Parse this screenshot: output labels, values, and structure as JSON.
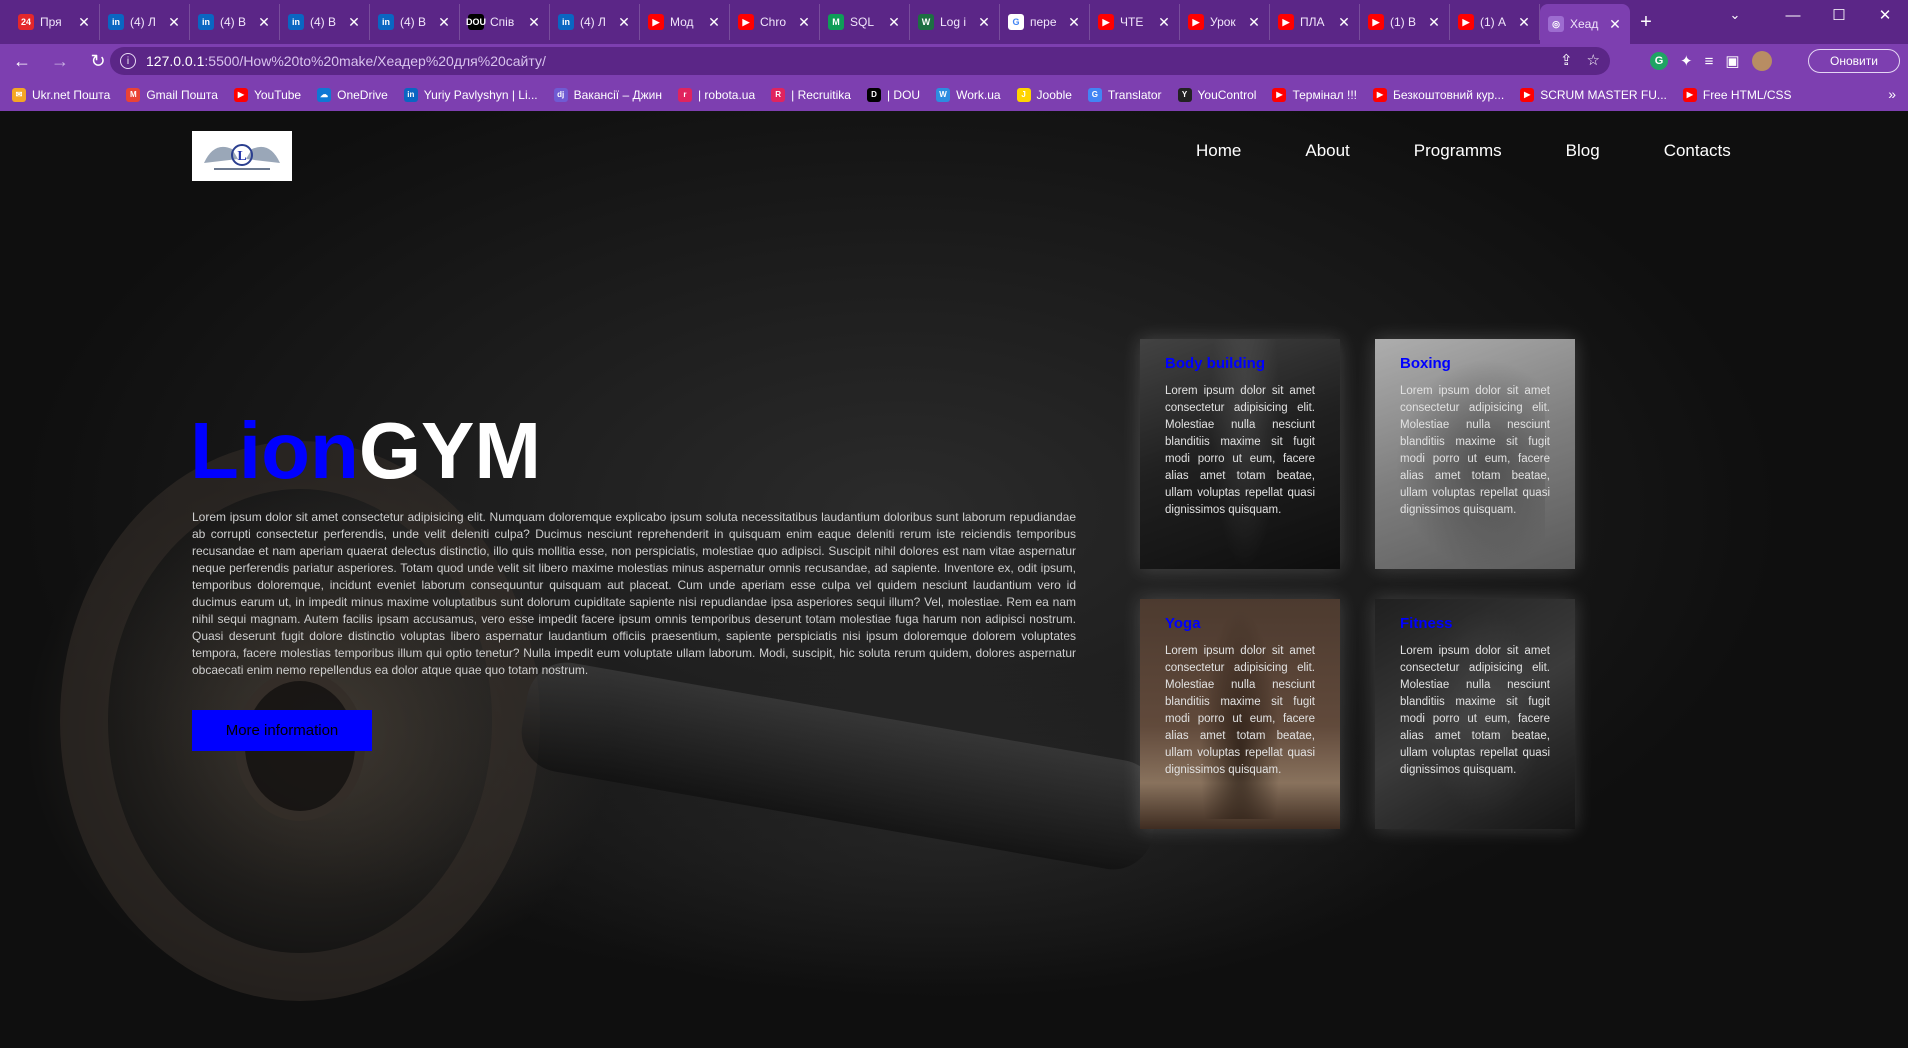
{
  "browser": {
    "tabs": [
      {
        "title": "Пря",
        "icon": "news24-icon",
        "color": "#e4272b",
        "glyph": "24"
      },
      {
        "title": "(4) Л",
        "icon": "linkedin-icon",
        "color": "#0a66c2",
        "glyph": "in"
      },
      {
        "title": "(4) В",
        "icon": "linkedin-icon",
        "color": "#0a66c2",
        "glyph": "in"
      },
      {
        "title": "(4) В",
        "icon": "linkedin-icon",
        "color": "#0a66c2",
        "glyph": "in"
      },
      {
        "title": "(4) В",
        "icon": "linkedin-icon",
        "color": "#0a66c2",
        "glyph": "in"
      },
      {
        "title": "Спів",
        "icon": "dou-icon",
        "color": "#000000",
        "glyph": "DOU"
      },
      {
        "title": "(4) Л",
        "icon": "linkedin-icon",
        "color": "#0a66c2",
        "glyph": "in"
      },
      {
        "title": "Мод",
        "icon": "youtube-icon",
        "color": "#ff0000",
        "glyph": "▶"
      },
      {
        "title": "Chro",
        "icon": "youtube-icon",
        "color": "#ff0000",
        "glyph": "▶"
      },
      {
        "title": "SQL",
        "icon": "sql-icon",
        "color": "#0f9d58",
        "glyph": "M"
      },
      {
        "title": "Log i",
        "icon": "w-icon",
        "color": "#1d6f42",
        "glyph": "W"
      },
      {
        "title": "пере",
        "icon": "google-icon",
        "color": "#ffffff",
        "glyph": "G"
      },
      {
        "title": "ЧТЕ",
        "icon": "youtube-icon",
        "color": "#ff0000",
        "glyph": "▶"
      },
      {
        "title": "Урок",
        "icon": "youtube-icon",
        "color": "#ff0000",
        "glyph": "▶"
      },
      {
        "title": "ПЛА",
        "icon": "youtube-icon",
        "color": "#ff0000",
        "glyph": "▶"
      },
      {
        "title": "(1) В",
        "icon": "youtube-icon",
        "color": "#ff0000",
        "glyph": "▶"
      },
      {
        "title": "(1) А",
        "icon": "youtube-icon",
        "color": "#ff0000",
        "glyph": "▶"
      },
      {
        "title": "Хеад",
        "icon": "globe-icon",
        "color": "#9d6cd0",
        "glyph": "◎",
        "active": true
      }
    ],
    "url_host": "127.0.0.1",
    "url_path": ":5500/How%20to%20make/Хеадер%20для%20сайту/",
    "update_label": "Оновити",
    "bookmarks": [
      {
        "label": "Ukr.net Пошта",
        "color": "#f5a623",
        "glyph": "✉"
      },
      {
        "label": "Gmail Пошта",
        "color": "#ea4335",
        "glyph": "M"
      },
      {
        "label": "YouTube",
        "color": "#ff0000",
        "glyph": "▶"
      },
      {
        "label": "OneDrive",
        "color": "#0f78d4",
        "glyph": "☁"
      },
      {
        "label": "Yuriy Pavlyshyn | Li...",
        "color": "#0a66c2",
        "glyph": "in"
      },
      {
        "label": "Вакансії – Джин",
        "color": "#6f5bd3",
        "glyph": "dj"
      },
      {
        "label": "| robota.ua",
        "color": "#e0245e",
        "glyph": "r"
      },
      {
        "label": "| Recruitika",
        "color": "#e0245e",
        "glyph": "R"
      },
      {
        "label": "| DOU",
        "color": "#000000",
        "glyph": "D"
      },
      {
        "label": "Work.ua",
        "color": "#2c8de0",
        "glyph": "W"
      },
      {
        "label": "Jooble",
        "color": "#ffd400",
        "glyph": "J"
      },
      {
        "label": "Translator",
        "color": "#4285f4",
        "glyph": "G"
      },
      {
        "label": "YouControl",
        "color": "#222222",
        "glyph": "Y"
      },
      {
        "label": "Термінал !!!",
        "color": "#ff0000",
        "glyph": "▶"
      },
      {
        "label": "Безкоштовний кур...",
        "color": "#ff0000",
        "glyph": "▶"
      },
      {
        "label": "SCRUM MASTER FU...",
        "color": "#ff0000",
        "glyph": "▶"
      },
      {
        "label": "Free HTML/CSS",
        "color": "#ff0000",
        "glyph": "▶"
      }
    ]
  },
  "site": {
    "nav": [
      "Home",
      "About",
      "Programms",
      "Blog",
      "Contacts"
    ],
    "title_a": "Lion",
    "title_b": "GYM",
    "hero_text": "Lorem ipsum dolor sit amet consectetur adipisicing elit. Numquam doloremque explicabo ipsum soluta necessitatibus laudantium doloribus sunt laborum repudiandae ab corrupti consectetur perferendis, unde velit deleniti culpa? Ducimus nesciunt reprehenderit in quisquam enim eaque deleniti rerum iste reiciendis temporibus recusandae et nam aperiam quaerat delectus distinctio, illo quis mollitia esse, non perspiciatis, molestiae quo adipisci. Suscipit nihil dolores est nam vitae aspernatur neque perferendis pariatur asperiores. Totam quod unde velit sit libero maxime molestias minus aspernatur omnis recusandae, ad sapiente. Inventore ex, odit ipsum, temporibus doloremque, incidunt eveniet laborum consequuntur quisquam aut placeat. Cum unde aperiam esse culpa vel quidem nesciunt laudantium vero id ducimus earum ut, in impedit minus maxime voluptatibus sunt dolorum cupiditate sapiente nisi repudiandae ipsa asperiores sequi illum? Vel, molestiae. Rem ea nam nihil sequi magnam. Autem facilis ipsam accusamus, vero esse impedit facere ipsum omnis temporibus deserunt totam molestiae fuga harum non adipisci nostrum. Quasi deserunt fugit dolore distinctio voluptas libero aspernatur laudantium officiis praesentium, sapiente perspiciatis nisi ipsum doloremque dolorem voluptates tempora, facere molestias temporibus illum qui optio tenetur? Nulla impedit eum voluptate ullam laborum. Modi, suscipit, hic soluta rerum quidem, dolores aspernatur obcaecati enim nemo repellendus ea dolor atque quae quo totam nostrum.",
    "button": "More information",
    "cards": [
      {
        "title": "Body building",
        "text": "Lorem ipsum dolor sit amet consectetur adipisicing elit. Molestiae nulla nesciunt blanditiis maxime sit fugit modi porro ut eum, facere alias amet totam beatae, ullam voluptas repellat quasi dignissimos quisquam."
      },
      {
        "title": "Boxing",
        "text": "Lorem ipsum dolor sit amet consectetur adipisicing elit. Molestiae nulla nesciunt blanditiis maxime sit fugit modi porro ut eum, facere alias amet totam beatae, ullam voluptas repellat quasi dignissimos quisquam."
      },
      {
        "title": "Yoga",
        "text": "Lorem ipsum dolor sit amet consectetur adipisicing elit. Molestiae nulla nesciunt blanditiis maxime sit fugit modi porro ut eum, facere alias amet totam beatae, ullam voluptas repellat quasi dignissimos quisquam."
      },
      {
        "title": "Fitness",
        "text": "Lorem ipsum dolor sit amet consectetur adipisicing elit. Molestiae nulla nesciunt blanditiis maxime sit fugit modi porro ut eum, facere alias amet totam beatae, ullam voluptas repellat quasi dignissimos quisquam."
      }
    ]
  }
}
